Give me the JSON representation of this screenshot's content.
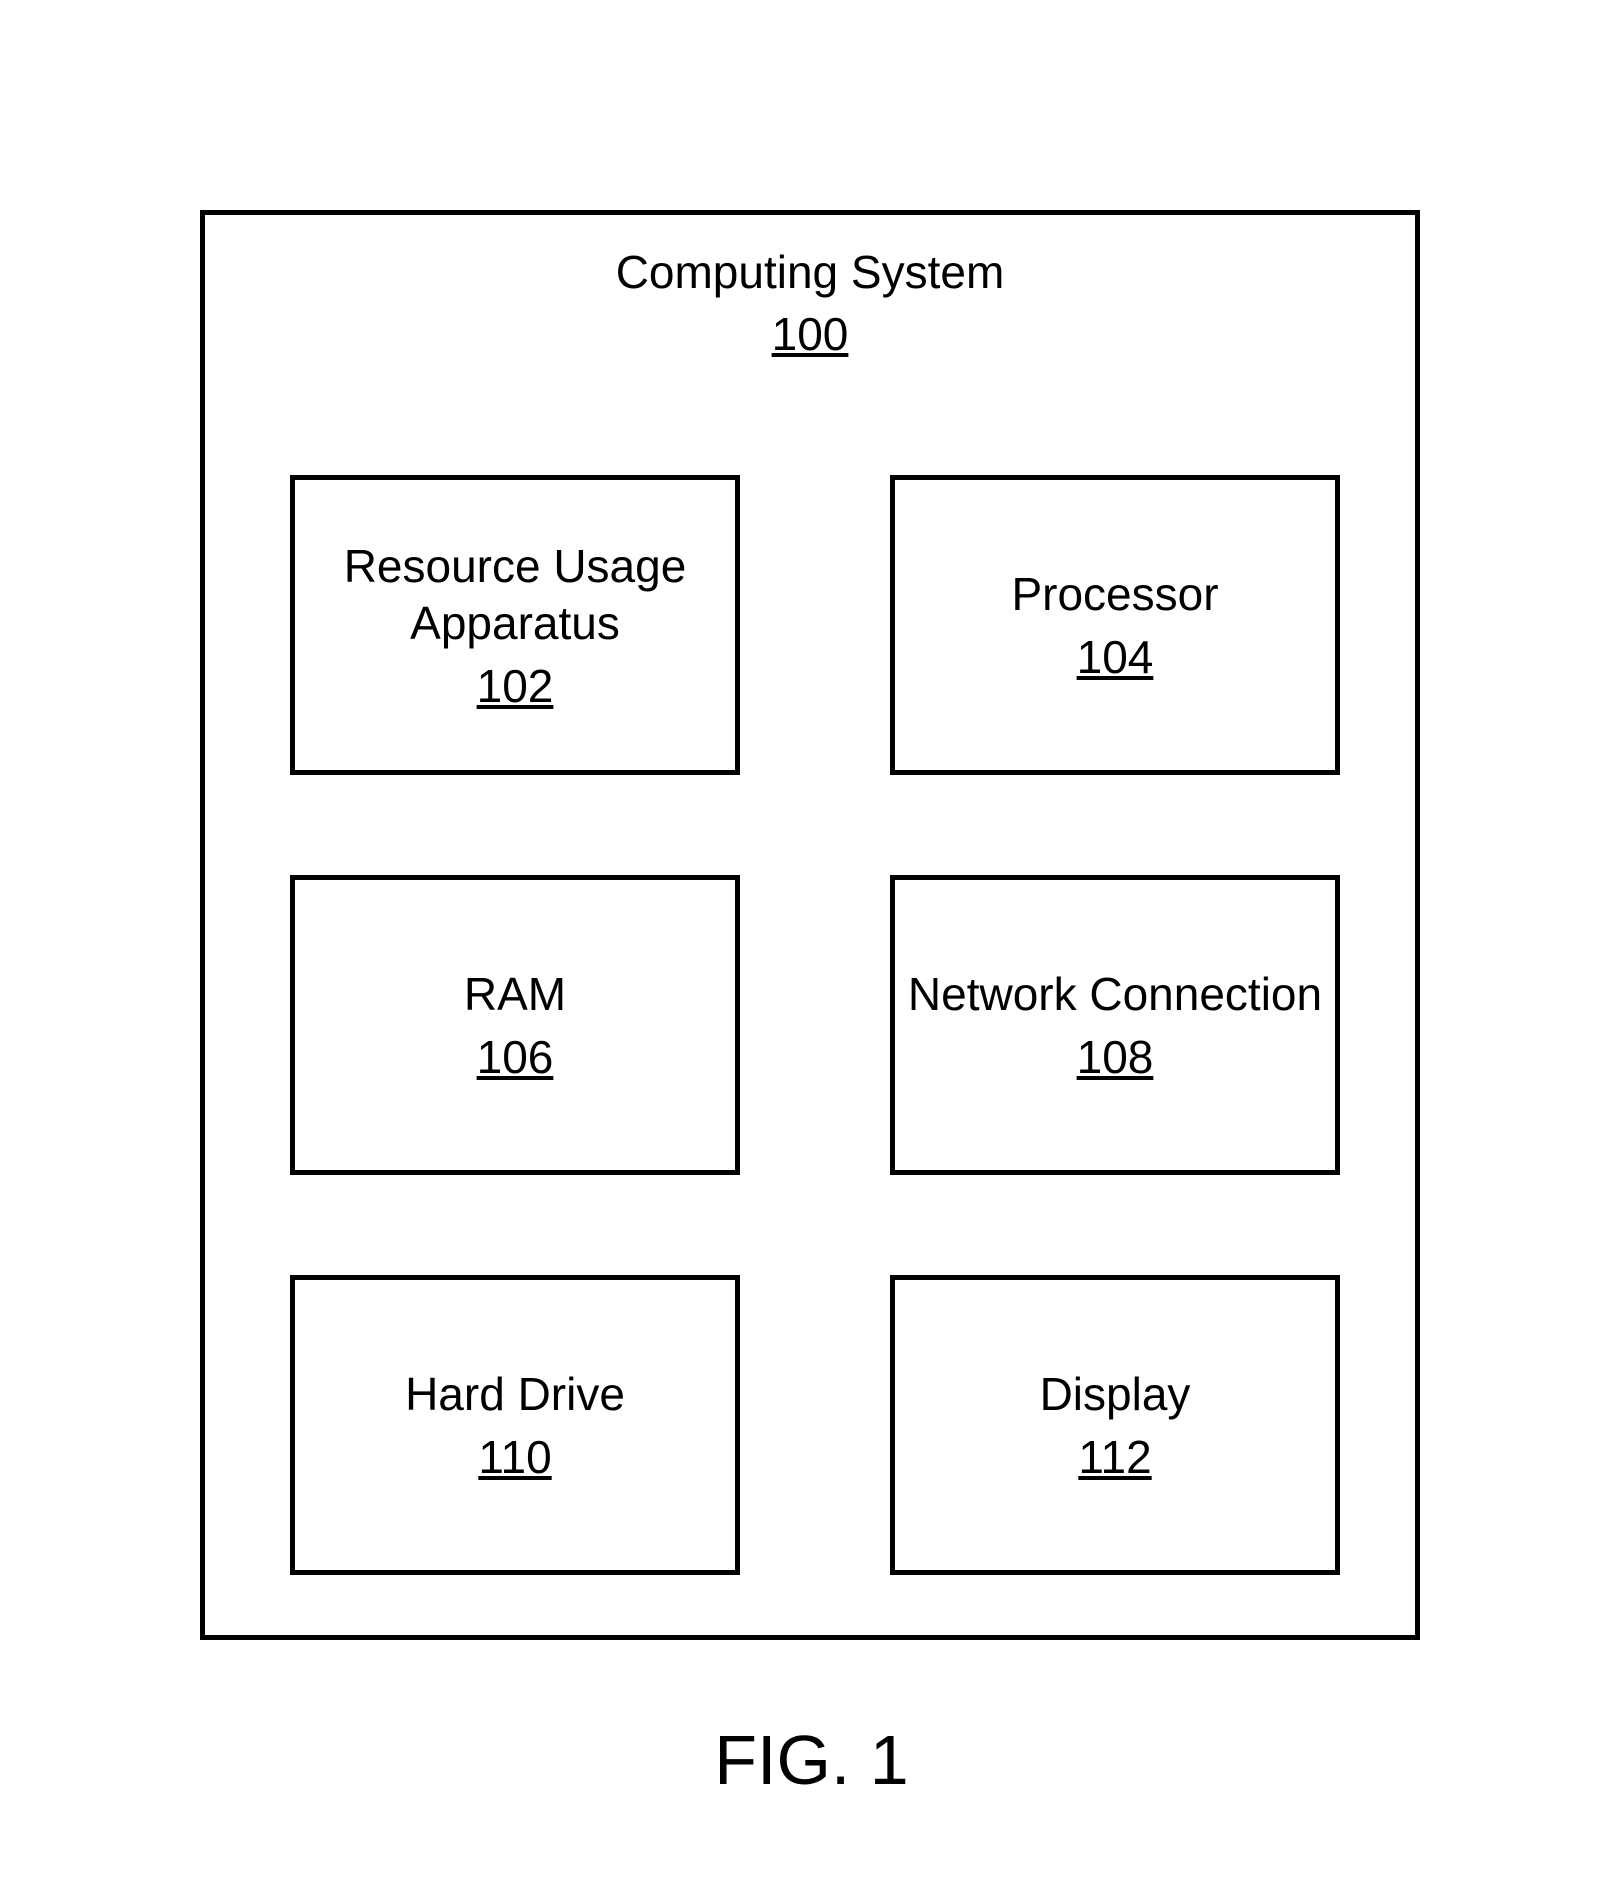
{
  "system": {
    "title": "Computing System",
    "ref": "100"
  },
  "components": [
    {
      "label": "Resource Usage Apparatus",
      "ref": "102"
    },
    {
      "label": "Processor",
      "ref": "104"
    },
    {
      "label": "RAM",
      "ref": "106"
    },
    {
      "label": "Network Connection",
      "ref": "108"
    },
    {
      "label": "Hard Drive",
      "ref": "110"
    },
    {
      "label": "Display",
      "ref": "112"
    }
  ],
  "figure_caption": "FIG. 1"
}
